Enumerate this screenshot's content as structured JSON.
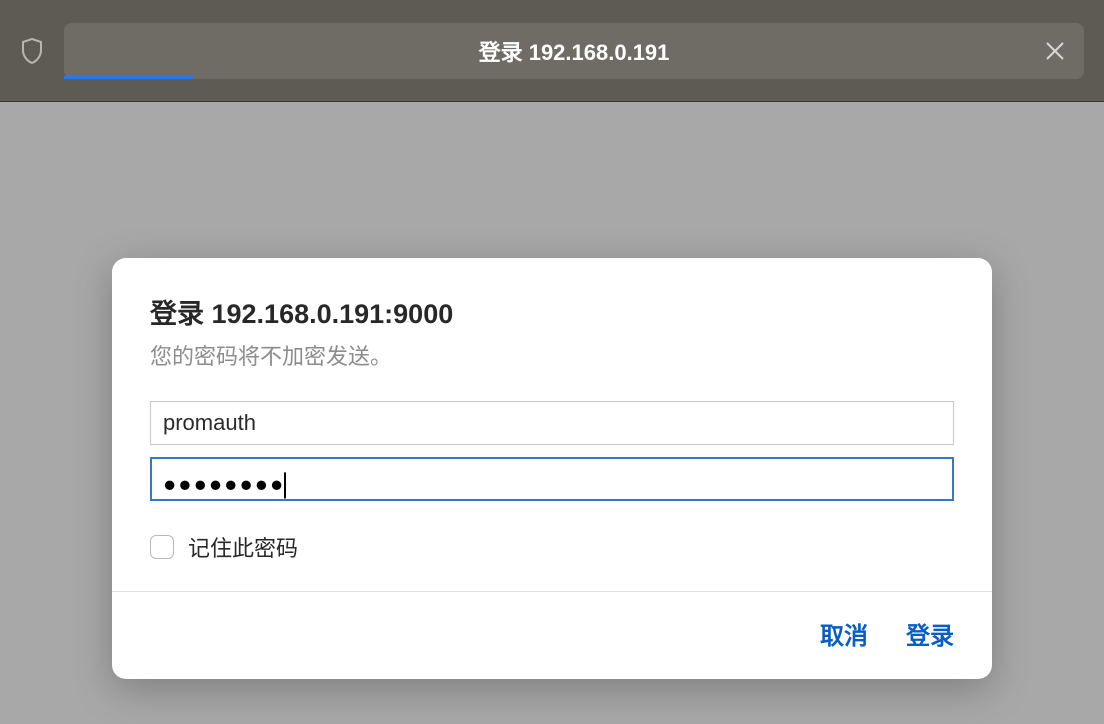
{
  "topbar": {
    "address_text": "登录 192.168.0.191"
  },
  "modal": {
    "title": "登录 192.168.0.191:9000",
    "subtitle": "您的密码将不加密发送。",
    "username_value": "promauth",
    "password_display": "●●●●●●●●",
    "remember_label": "记住此密码",
    "cancel_label": "取消",
    "login_label": "登录"
  }
}
